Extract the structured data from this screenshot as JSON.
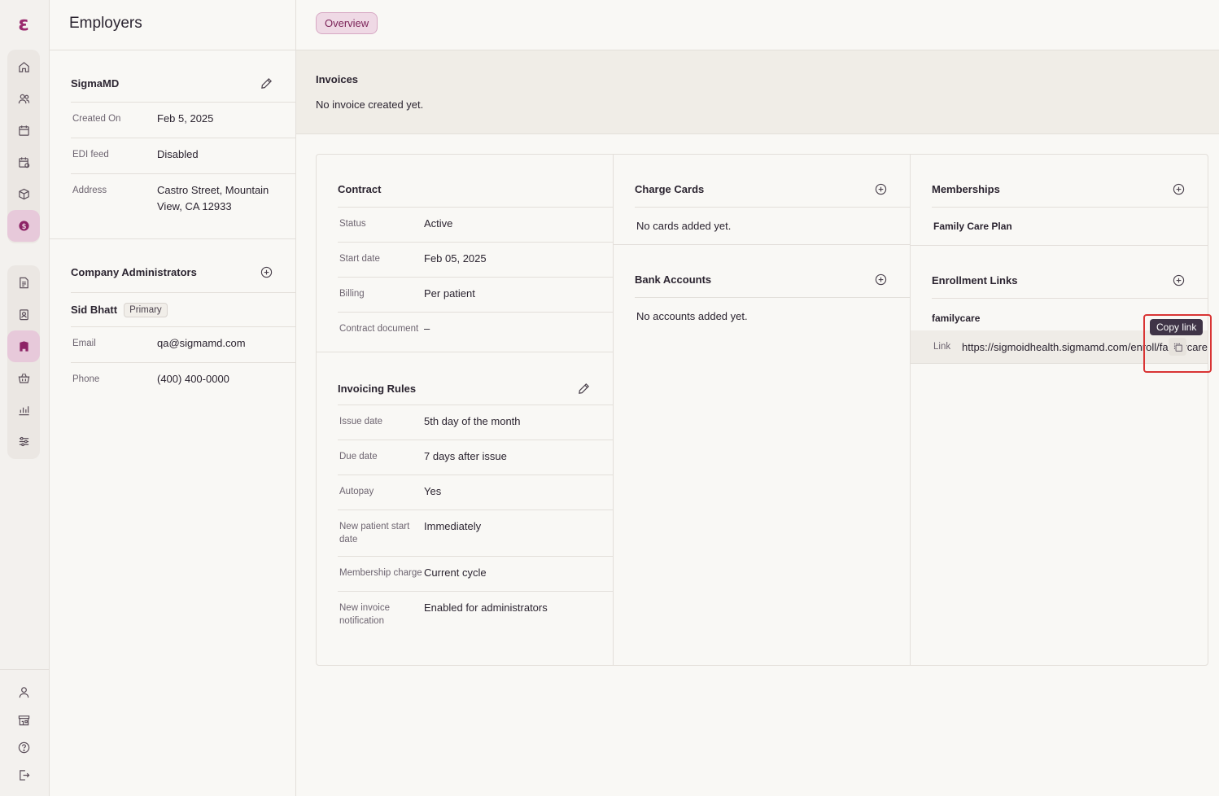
{
  "nav": {
    "logo": "ε",
    "primary_icons": [
      "home-icon",
      "users-icon",
      "calendar-icon",
      "calendar-check-icon",
      "package-icon",
      "dollar-icon"
    ],
    "secondary_icons": [
      "document-icon",
      "badge-icon",
      "building-icon",
      "basket-icon",
      "chart-icon",
      "sliders-icon"
    ],
    "bottom_icons": [
      "user-icon",
      "store-icon",
      "help-icon",
      "logout-icon"
    ]
  },
  "employer": {
    "page_title": "Employers",
    "name": "SigmaMD",
    "fields": [
      {
        "label": "Created On",
        "value": "Feb 5, 2025"
      },
      {
        "label": "EDI feed",
        "value": "Disabled"
      },
      {
        "label": "Address",
        "value": "Castro Street, Mountain View, CA 12933"
      }
    ]
  },
  "admins": {
    "title": "Company Administrators",
    "name": "Sid Bhatt",
    "badge": "Primary",
    "fields": [
      {
        "label": "Email",
        "value": "qa@sigmamd.com"
      },
      {
        "label": "Phone",
        "value": "(400) 400-0000"
      }
    ]
  },
  "tabs": {
    "overview": "Overview"
  },
  "invoices": {
    "title": "Invoices",
    "empty": "No invoice created yet."
  },
  "contract": {
    "title": "Contract",
    "fields": [
      {
        "label": "Status",
        "value": "Active"
      },
      {
        "label": "Start date",
        "value": "Feb 05, 2025"
      },
      {
        "label": "Billing",
        "value": "Per patient"
      },
      {
        "label": "Contract document",
        "value": "–"
      }
    ]
  },
  "invoicing_rules": {
    "title": "Invoicing Rules",
    "fields": [
      {
        "label": "Issue date",
        "value": "5th day of the month"
      },
      {
        "label": "Due date",
        "value": "7 days after issue"
      },
      {
        "label": "Autopay",
        "value": "Yes"
      },
      {
        "label": "New patient start date",
        "value": "Immediately"
      },
      {
        "label": "Membership charge",
        "value": "Current cycle"
      },
      {
        "label": "New invoice notification",
        "value": "Enabled for administrators"
      }
    ]
  },
  "charge_cards": {
    "title": "Charge Cards",
    "empty": "No cards added yet."
  },
  "bank_accounts": {
    "title": "Bank Accounts",
    "empty": "No accounts added yet."
  },
  "memberships": {
    "title": "Memberships",
    "plan": "Family Care Plan"
  },
  "enrollment": {
    "title": "Enrollment Links",
    "name": "familycare",
    "link_label": "Link",
    "link_value": "https://sigmoidhealth.sigmamd.com/enroll/familycare",
    "tooltip": "Copy link"
  }
}
